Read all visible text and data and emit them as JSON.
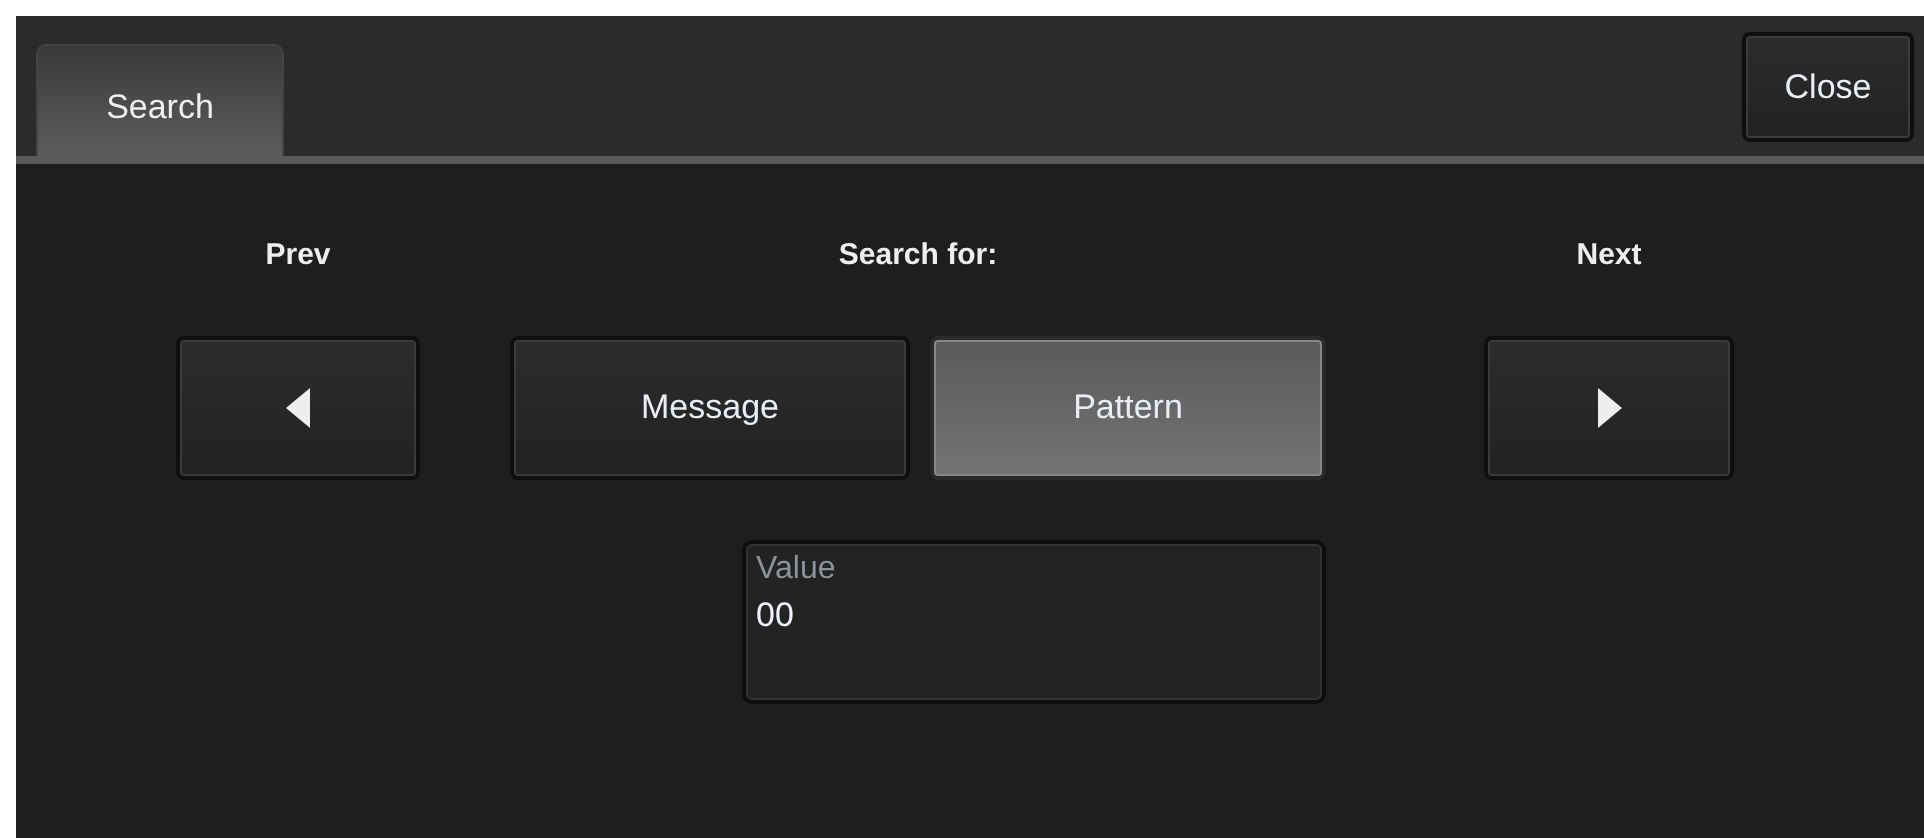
{
  "tabs": [
    {
      "label": "Search",
      "selected": true
    }
  ],
  "close_button": "Close",
  "prev": {
    "label": "Prev"
  },
  "search_for": {
    "label": "Search for:",
    "options": [
      {
        "label": "Message",
        "selected": false
      },
      {
        "label": "Pattern",
        "selected": true
      }
    ]
  },
  "next": {
    "label": "Next"
  },
  "value_field": {
    "label": "Value",
    "value": "00"
  }
}
